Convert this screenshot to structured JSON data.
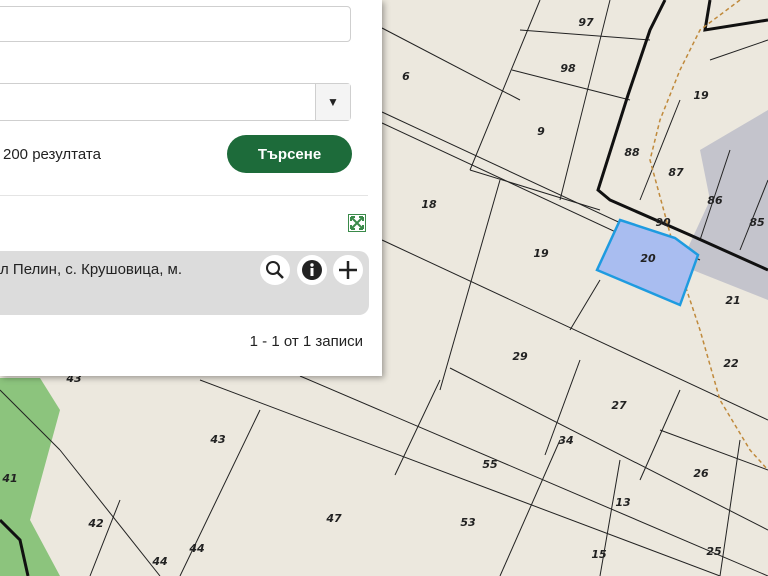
{
  "map": {
    "parcel_labels": [
      "97",
      "6",
      "98",
      "19",
      "9",
      "88",
      "87",
      "86",
      "85",
      "90",
      "18",
      "19",
      "20",
      "21",
      "22",
      "29",
      "27",
      "34",
      "43",
      "43",
      "41",
      "42",
      "44",
      "44",
      "47",
      "55",
      "53",
      "13",
      "26",
      "15",
      "25"
    ],
    "highlighted_parcel": "20",
    "colors": {
      "background": "#ece8de",
      "highlight_fill": "#a9bdf0",
      "highlight_stroke": "#1e9be0",
      "forest": "#8cc47d",
      "built_area": "#c4c4cc",
      "trail": "#c08a3c"
    }
  },
  "panel": {
    "field1_value": "",
    "field2_value": "",
    "dropdown_arrow": "▼",
    "result_count_text": "200 резултата",
    "search_button": "Търсене",
    "results": [
      {
        "text": "л Пелин, с. Крушовица, м."
      }
    ],
    "pager_text": "1 - 1 от 1 записи",
    "icons": [
      "search-icon",
      "info-icon",
      "add-icon",
      "expand-icon"
    ]
  }
}
